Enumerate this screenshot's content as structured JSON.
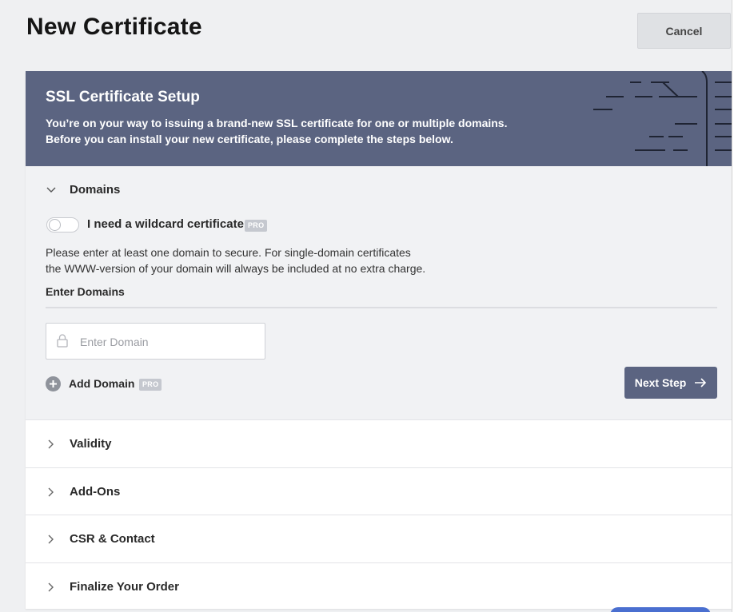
{
  "header": {
    "title": "New Certificate",
    "cancel_label": "Cancel"
  },
  "hero": {
    "title": "SSL Certificate Setup",
    "line1": "You’re on your way to issuing a brand-new SSL certificate for one or multiple domains.",
    "line2": "Before you can install your new certificate, please complete the steps below."
  },
  "domains": {
    "label": "Domains",
    "wildcard_label": "I need a wildcard certificate",
    "wildcard_enabled": false,
    "pro_badge": "PRO",
    "info_line1": "Please enter at least one domain to secure. For single-domain certificates",
    "info_line2": "the WWW-version of your domain will always be included at no extra charge.",
    "enter_label": "Enter Domains",
    "input_placeholder": "Enter Domain",
    "input_value": "",
    "add_label": "Add Domain",
    "next_label": "Next Step"
  },
  "steps": [
    {
      "label": "Validity"
    },
    {
      "label": "Add-Ons"
    },
    {
      "label": "CSR & Contact"
    },
    {
      "label": "Finalize Your Order"
    }
  ],
  "colors": {
    "hero_bg": "#5b6481",
    "primary_button": "#5b6481",
    "page_bg": "#eff0f2",
    "section_bg": "#f1f2f4",
    "pro_badge_bg": "#c5c8cf"
  },
  "icons": {
    "expanded_chevron": "chevron-down-icon",
    "collapsed_chevron": "chevron-right-icon",
    "input_icon": "lock-icon",
    "add_icon": "plus-circle-icon",
    "next_icon": "arrow-right-icon"
  }
}
